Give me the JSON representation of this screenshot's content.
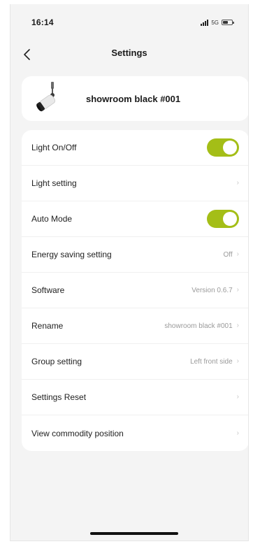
{
  "status": {
    "time": "16:14",
    "network": "5G"
  },
  "nav": {
    "title": "Settings"
  },
  "device": {
    "name": "showroom black #001"
  },
  "settings": {
    "light_on_off": {
      "label": "Light On/Off",
      "on": true
    },
    "light_setting": {
      "label": "Light setting"
    },
    "auto_mode": {
      "label": "Auto Mode",
      "on": true
    },
    "energy_saving": {
      "label": "Energy saving setting",
      "value": "Off"
    },
    "software": {
      "label": "Software",
      "value": "Version 0.6.7"
    },
    "rename": {
      "label": "Rename",
      "value": "showroom black #001"
    },
    "group_setting": {
      "label": "Group setting",
      "value": "Left front side"
    },
    "settings_reset": {
      "label": "Settings Reset"
    },
    "view_commodity": {
      "label": "View commodity position"
    }
  },
  "colors": {
    "accent": "#a4be17",
    "background": "#f4f4f4",
    "card": "#ffffff"
  }
}
